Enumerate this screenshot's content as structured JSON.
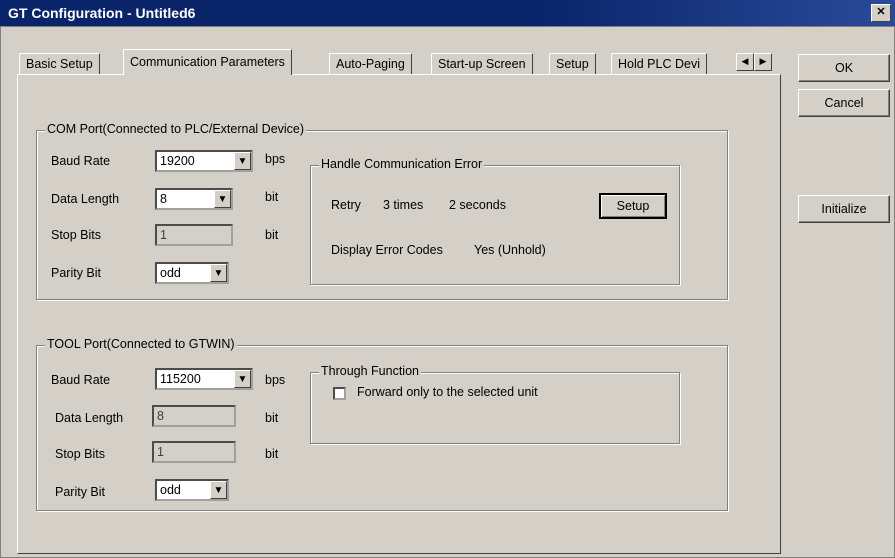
{
  "window": {
    "title": "GT Configuration - Untitled6",
    "close_label": "✕"
  },
  "tabs": [
    "Basic Setup",
    "Communication Parameters",
    "Auto-Paging",
    "Start-up Screen",
    "Setup",
    "Hold PLC Devi"
  ],
  "active_tab": 1,
  "side_buttons": {
    "ok": "OK",
    "cancel": "Cancel",
    "initialize": "Initialize"
  },
  "com_port": {
    "title": "COM Port(Connected to PLC/External Device)",
    "baud_rate": {
      "label": "Baud Rate",
      "value": "19200",
      "unit": "bps"
    },
    "data_length": {
      "label": "Data Length",
      "value": "8",
      "unit": "bit"
    },
    "stop_bits": {
      "label": "Stop Bits",
      "value": "1",
      "unit": "bit"
    },
    "parity_bit": {
      "label": "Parity Bit",
      "value": "odd"
    }
  },
  "handle_error": {
    "title": "Handle Communication Error",
    "retry_label": "Retry",
    "retry_times": "3 times",
    "retry_seconds": "2 seconds",
    "setup_button": "Setup",
    "display_error_label": "Display Error Codes",
    "display_error_value": "Yes (Unhold)"
  },
  "tool_port": {
    "title": "TOOL Port(Connected to GTWIN)",
    "baud_rate": {
      "label": "Baud Rate",
      "value": "115200",
      "unit": "bps"
    },
    "data_length": {
      "label": "Data Length",
      "value": "8",
      "unit": "bit"
    },
    "stop_bits": {
      "label": "Stop Bits",
      "value": "1",
      "unit": "bit"
    },
    "parity_bit": {
      "label": "Parity Bit",
      "value": "odd"
    }
  },
  "through_function": {
    "title": "Through Function",
    "checkbox_label": "Forward only to the selected unit",
    "checked": false
  }
}
